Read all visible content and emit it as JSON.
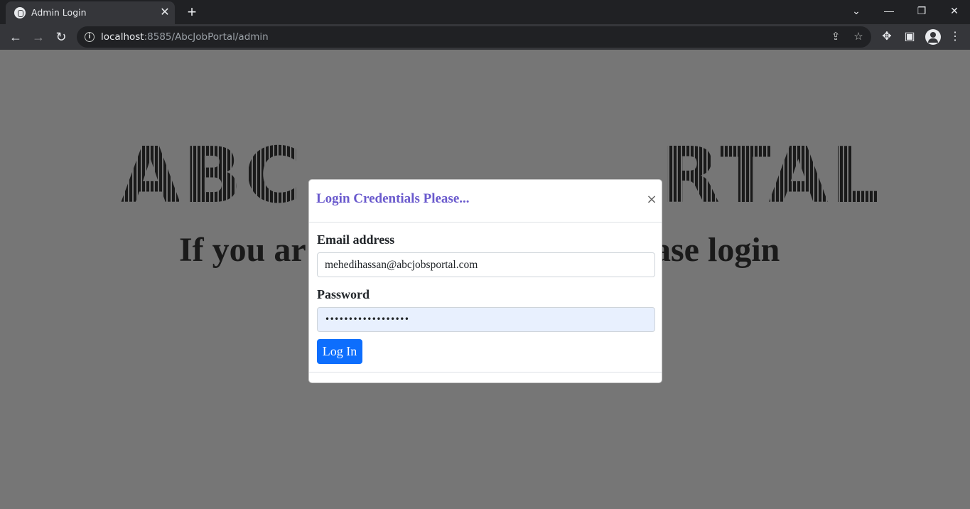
{
  "browser": {
    "tab": {
      "title": "Admin Login",
      "close_glyph": "✕"
    },
    "new_tab_glyph": "+",
    "url": {
      "host": "localhost",
      "rest": ":8585/AbcJobPortal/admin"
    },
    "window_controls": {
      "tab_search": "⌄",
      "minimize": "—",
      "restore": "❐",
      "close": "✕"
    },
    "nav": {
      "back": "←",
      "forward": "→",
      "reload": "↻"
    },
    "icons": [
      "share-icon",
      "star-icon",
      "extensions-icon",
      "side-panel-icon",
      "profile-icon",
      "menu-icon"
    ]
  },
  "page": {
    "hero_left": "ABC",
    "hero_right": "RTAL",
    "subtitle_left": "If you ar",
    "subtitle_right": "ase login"
  },
  "modal": {
    "title": "Login Credentials Please...",
    "email_label": "Email address",
    "email_value": "mehedihassan@abcjobsportal.com",
    "password_label": "Password",
    "password_value": "••••••••••••••••••",
    "login_button": "Log In",
    "close_glyph": "×",
    "title_color": "#6a5acd",
    "button_color": "#0d6efd"
  }
}
